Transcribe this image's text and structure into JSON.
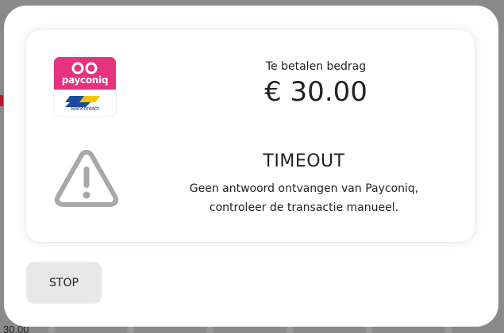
{
  "background": {
    "bottom_value": "30.00"
  },
  "dialog": {
    "logo": {
      "brand": "payconiq",
      "sub_brand": "Bancontact",
      "brand_color": "#e6337e"
    },
    "amount_label": "Te betalen bedrag",
    "amount_value": "€ 30.00",
    "status_icon": "warning-triangle-icon",
    "status_title": "TIMEOUT",
    "status_message_line1": "Geen antwoord ontvangen van Payconiq,",
    "status_message_line2": "controleer de transactie manueel.",
    "stop_button_label": "STOP"
  }
}
